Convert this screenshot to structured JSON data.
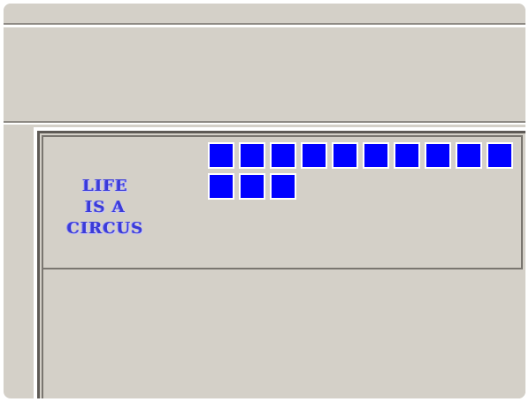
{
  "logo": {
    "lines": [
      "LIFE",
      "IS A",
      "CIRCUS"
    ]
  },
  "tiles": {
    "count": 13,
    "color": "#0000ff"
  }
}
